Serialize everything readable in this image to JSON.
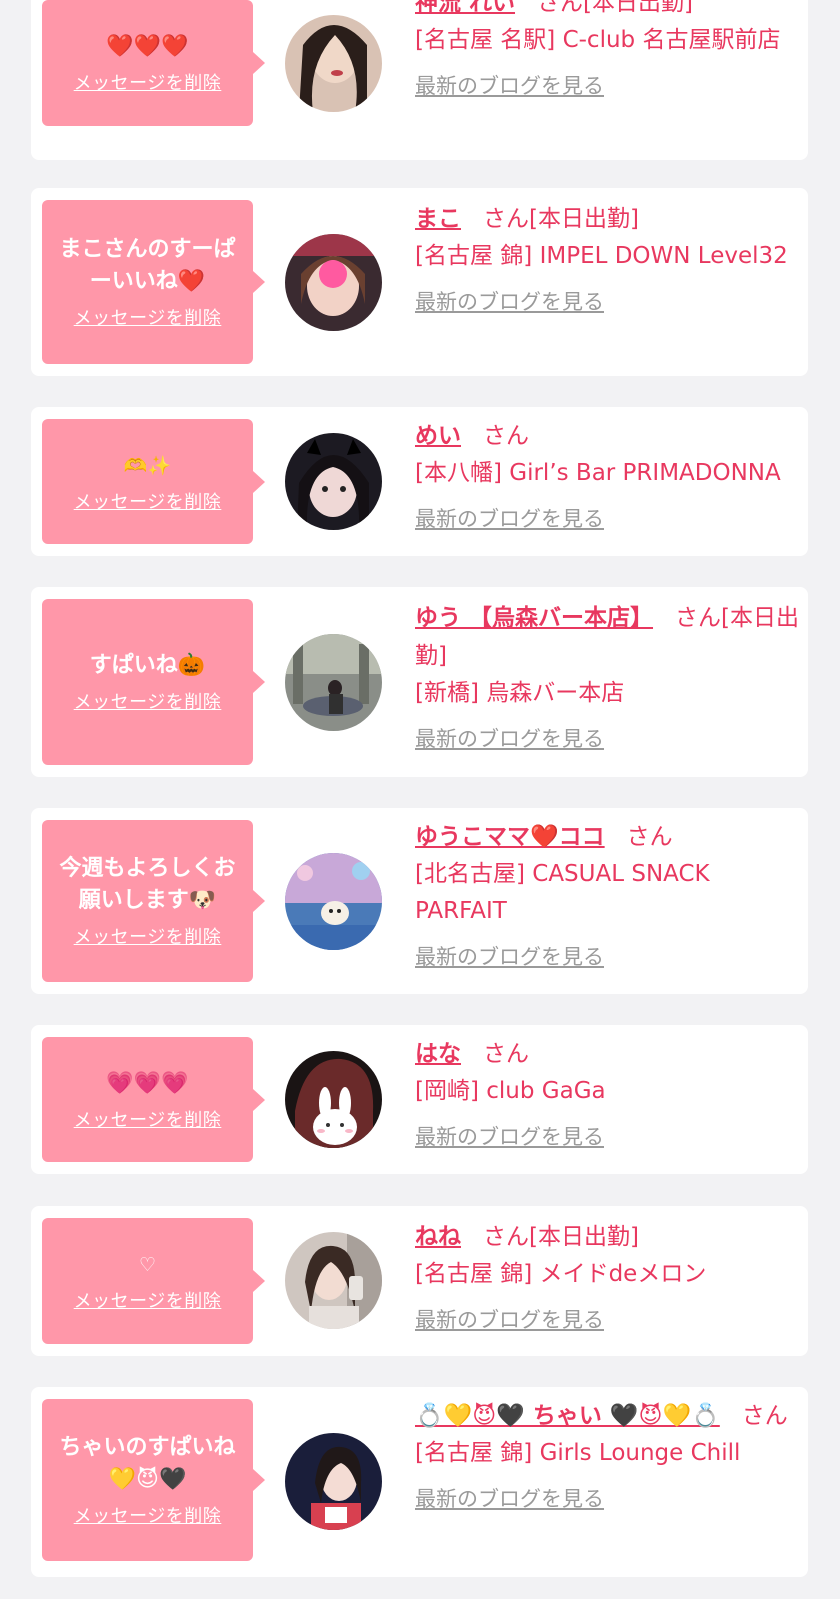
{
  "cards": [
    {
      "message": "❤️❤️❤️",
      "delete_label": "メッセージを削除",
      "name": "神流 れい",
      "san": "さん",
      "status": "[本日出勤]",
      "shop": "[名古屋 名駅] C-club 名古屋駅前店",
      "blog": "最新のブログを見る"
    },
    {
      "message": "まこさんのすーぱーいいね❤️",
      "delete_label": "メッセージを削除",
      "name": "まこ",
      "san": "さん",
      "status": "[本日出勤]",
      "shop": "[名古屋 錦] IMPEL DOWN Level32",
      "blog": "最新のブログを見る"
    },
    {
      "message": "🫶✨",
      "delete_label": "メッセージを削除",
      "name": "めい",
      "san": "さん",
      "status": "",
      "shop": "[本八幡] Girl’s Bar PRIMADONNA",
      "blog": "最新のブログを見る"
    },
    {
      "message": "すぱいね🎃",
      "delete_label": "メッセージを削除",
      "name": "ゆう 【烏森バー本店】",
      "san": "さん",
      "status": "[本日出勤]",
      "shop": "[新橋] 烏森バー本店",
      "blog": "最新のブログを見る"
    },
    {
      "message": "今週もよろしくお願いします🐶",
      "delete_label": "メッセージを削除",
      "name": "ゆうこママ❤️ココ",
      "san": "さん",
      "status": "",
      "shop": "[北名古屋] CASUAL SNACK PARFAIT",
      "blog": "最新のブログを見る"
    },
    {
      "message": "💗💗💗",
      "delete_label": "メッセージを削除",
      "name": "はな",
      "san": "さん",
      "status": "",
      "shop": "[岡崎] club GaGa",
      "blog": "最新のブログを見る"
    },
    {
      "message": "♡",
      "delete_label": "メッセージを削除",
      "name": "ねね",
      "san": "さん",
      "status": "[本日出勤]",
      "shop": "[名古屋 錦] メイドdeメロン",
      "blog": "最新のブログを見る"
    },
    {
      "message": "ちゃいのすぱいね💛😈🖤",
      "delete_label": "メッセージを削除",
      "name": "💍💛😈🖤 ちゃい 🖤😈💛💍",
      "san": "さん",
      "status": "",
      "shop": "[名古屋 錦] Girls Lounge Chill",
      "blog": "最新のブログを見る"
    }
  ]
}
